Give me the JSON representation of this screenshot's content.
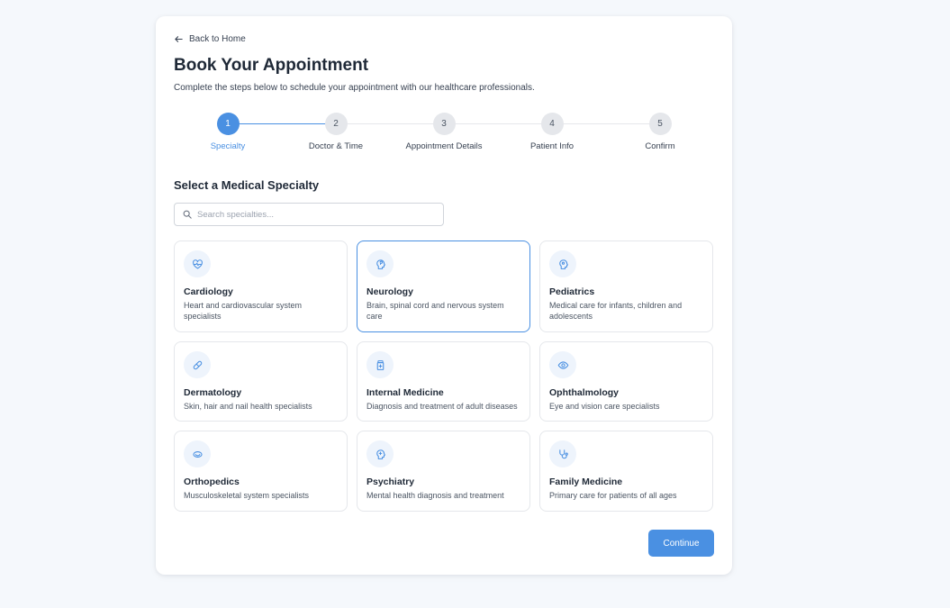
{
  "back_link": {
    "label": "Back to Home",
    "icon": "arrow-left-icon"
  },
  "header": {
    "title": "Book Your Appointment",
    "subtitle": "Complete the steps below to schedule your appointment with our healthcare professionals."
  },
  "stepper": {
    "active_step": 1,
    "steps": [
      {
        "number": "1",
        "label": "Specialty"
      },
      {
        "number": "2",
        "label": "Doctor & Time"
      },
      {
        "number": "3",
        "label": "Appointment Details"
      },
      {
        "number": "4",
        "label": "Patient Info"
      },
      {
        "number": "5",
        "label": "Confirm"
      }
    ]
  },
  "section": {
    "title": "Select a Medical Specialty"
  },
  "search": {
    "placeholder": "Search specialties...",
    "value": "",
    "icon": "search-icon"
  },
  "specialties": [
    {
      "name": "Cardiology",
      "description": "Heart and cardiovascular system specialists",
      "icon": "heart-pulse-icon",
      "selected": false
    },
    {
      "name": "Neurology",
      "description": "Brain, spinal cord and nervous system care",
      "icon": "brain-icon",
      "selected": true
    },
    {
      "name": "Pediatrics",
      "description": "Medical care for infants, children and adolescents",
      "icon": "baby-icon",
      "selected": false
    },
    {
      "name": "Dermatology",
      "description": "Skin, hair and nail health specialists",
      "icon": "bandage-icon",
      "selected": false
    },
    {
      "name": "Internal Medicine",
      "description": "Diagnosis and treatment of adult diseases",
      "icon": "medicine-bottle-icon",
      "selected": false
    },
    {
      "name": "Ophthalmology",
      "description": "Eye and vision care specialists",
      "icon": "eye-icon",
      "selected": false
    },
    {
      "name": "Orthopedics",
      "description": "Musculoskeletal system specialists",
      "icon": "bone-icon",
      "selected": false
    },
    {
      "name": "Psychiatry",
      "description": "Mental health diagnosis and treatment",
      "icon": "brain-icon",
      "selected": false
    },
    {
      "name": "Family Medicine",
      "description": "Primary care for patients of all ages",
      "icon": "stethoscope-icon",
      "selected": false
    }
  ],
  "actions": {
    "continue_label": "Continue"
  },
  "colors": {
    "accent": "#4a90e2",
    "accent_light": "#eef4fc",
    "border": "#e5e7eb",
    "background": "#f5f8fc"
  }
}
